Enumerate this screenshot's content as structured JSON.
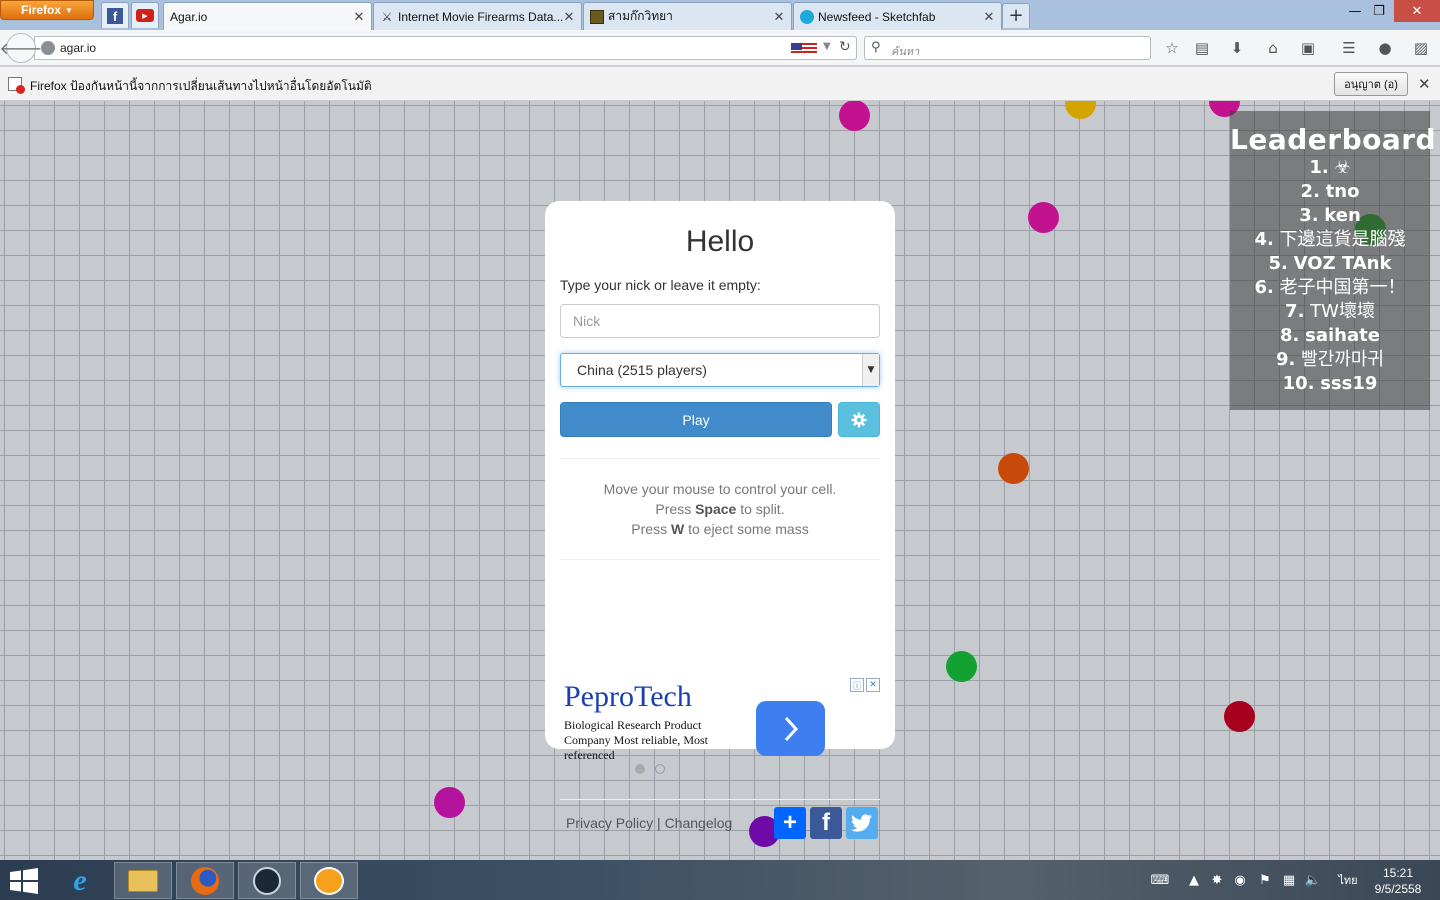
{
  "browser": {
    "menu_label": "Firefox",
    "tabs": [
      {
        "title": "Agar.io",
        "active": true
      },
      {
        "title": "Internet Movie Firearms Data...",
        "active": false
      },
      {
        "title": "สามก๊กวิทยา",
        "active": false
      },
      {
        "title": "Newsfeed - Sketchfab",
        "active": false
      }
    ],
    "url": "agar.io",
    "search_placeholder": "ค้นหา"
  },
  "notification": {
    "text": "Firefox ป้องกันหน้านี้จากการเปลี่ยนเส้นทางไปหน้าอื่นโดยอัตโนมัติ",
    "allow_label": "อนุญาต (อ)"
  },
  "leaderboard": {
    "title": "Leaderboard",
    "entries": [
      {
        "rank": "1.",
        "name": "☣"
      },
      {
        "rank": "2.",
        "name": "tno"
      },
      {
        "rank": "3.",
        "name": "ken"
      },
      {
        "rank": "4.",
        "name": "下邊這貨是腦殘"
      },
      {
        "rank": "5.",
        "name": "VOZ TAnk"
      },
      {
        "rank": "6.",
        "name": "老子中国第一！"
      },
      {
        "rank": "7.",
        "name": "TW壞壞"
      },
      {
        "rank": "8.",
        "name": "saihate"
      },
      {
        "rank": "9.",
        "name": "빨간까마귀"
      },
      {
        "rank": "10.",
        "name": "sss19"
      }
    ]
  },
  "dialog": {
    "title": "Hello",
    "nick_label": "Type your nick or leave it empty:",
    "nick_placeholder": "Nick",
    "region": "China (2515 players)",
    "play_label": "Play",
    "instructions": {
      "line1": "Move your mouse to control your cell.",
      "line2_pre": "Press ",
      "line2_key": "Space",
      "line2_post": " to split.",
      "line3_pre": "Press ",
      "line3_key": "W",
      "line3_post": " to eject some mass"
    },
    "ad": {
      "brand": "PeproTech",
      "text": "Biological Research Product Company Most reliable, Most referenced"
    },
    "footer": {
      "privacy": "Privacy Policy",
      "separator": " | ",
      "changelog": "Changelog"
    }
  },
  "taskbar": {
    "language": "ไทย",
    "time": "15:21",
    "date": "9/5/2558"
  },
  "colors": {
    "play_button": "#428bca",
    "settings_button": "#5bc0de",
    "cells": [
      "#c2128f",
      "#d4a300",
      "#c2128f",
      "#c2128f",
      "#22a52a",
      "#c84a0a",
      "#12a030",
      "#a6001e",
      "#b4129c",
      "#6d0aa8"
    ]
  }
}
